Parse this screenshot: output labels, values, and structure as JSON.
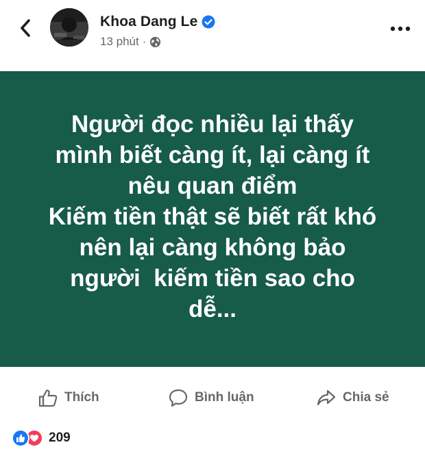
{
  "header": {
    "author_name": "Khoa Dang Le",
    "post_time": "13 phút",
    "separator": "·",
    "icons": {
      "back": "chevron-left-icon",
      "verified": "verified-badge-icon",
      "privacy": "globe-icon",
      "more": "more-horizontal-icon"
    }
  },
  "post": {
    "background_color": "#175b49",
    "text_color": "#ffffff",
    "lines": [
      "Người đọc nhiều lại thấy",
      "mình biết càng ít, lại càng ít",
      "nêu quan điểm",
      "Kiếm tiền thật sẽ biết rất khó",
      "nên lại càng không bảo",
      "người  kiếm tiền sao cho",
      "dễ..."
    ]
  },
  "actions": {
    "like_label": "Thích",
    "comment_label": "Bình luận",
    "share_label": "Chia sẻ",
    "icons": {
      "like": "thumbs-up-icon",
      "comment": "comment-bubble-icon",
      "share": "share-arrow-icon"
    }
  },
  "reactions": {
    "count": "209",
    "types": [
      "like",
      "love"
    ],
    "colors": {
      "like": "#1877f2",
      "love": "#f33e58"
    }
  },
  "colors": {
    "verified_blue": "#1877f2",
    "secondary_text": "#65676b",
    "primary_text": "#1c1e21"
  }
}
